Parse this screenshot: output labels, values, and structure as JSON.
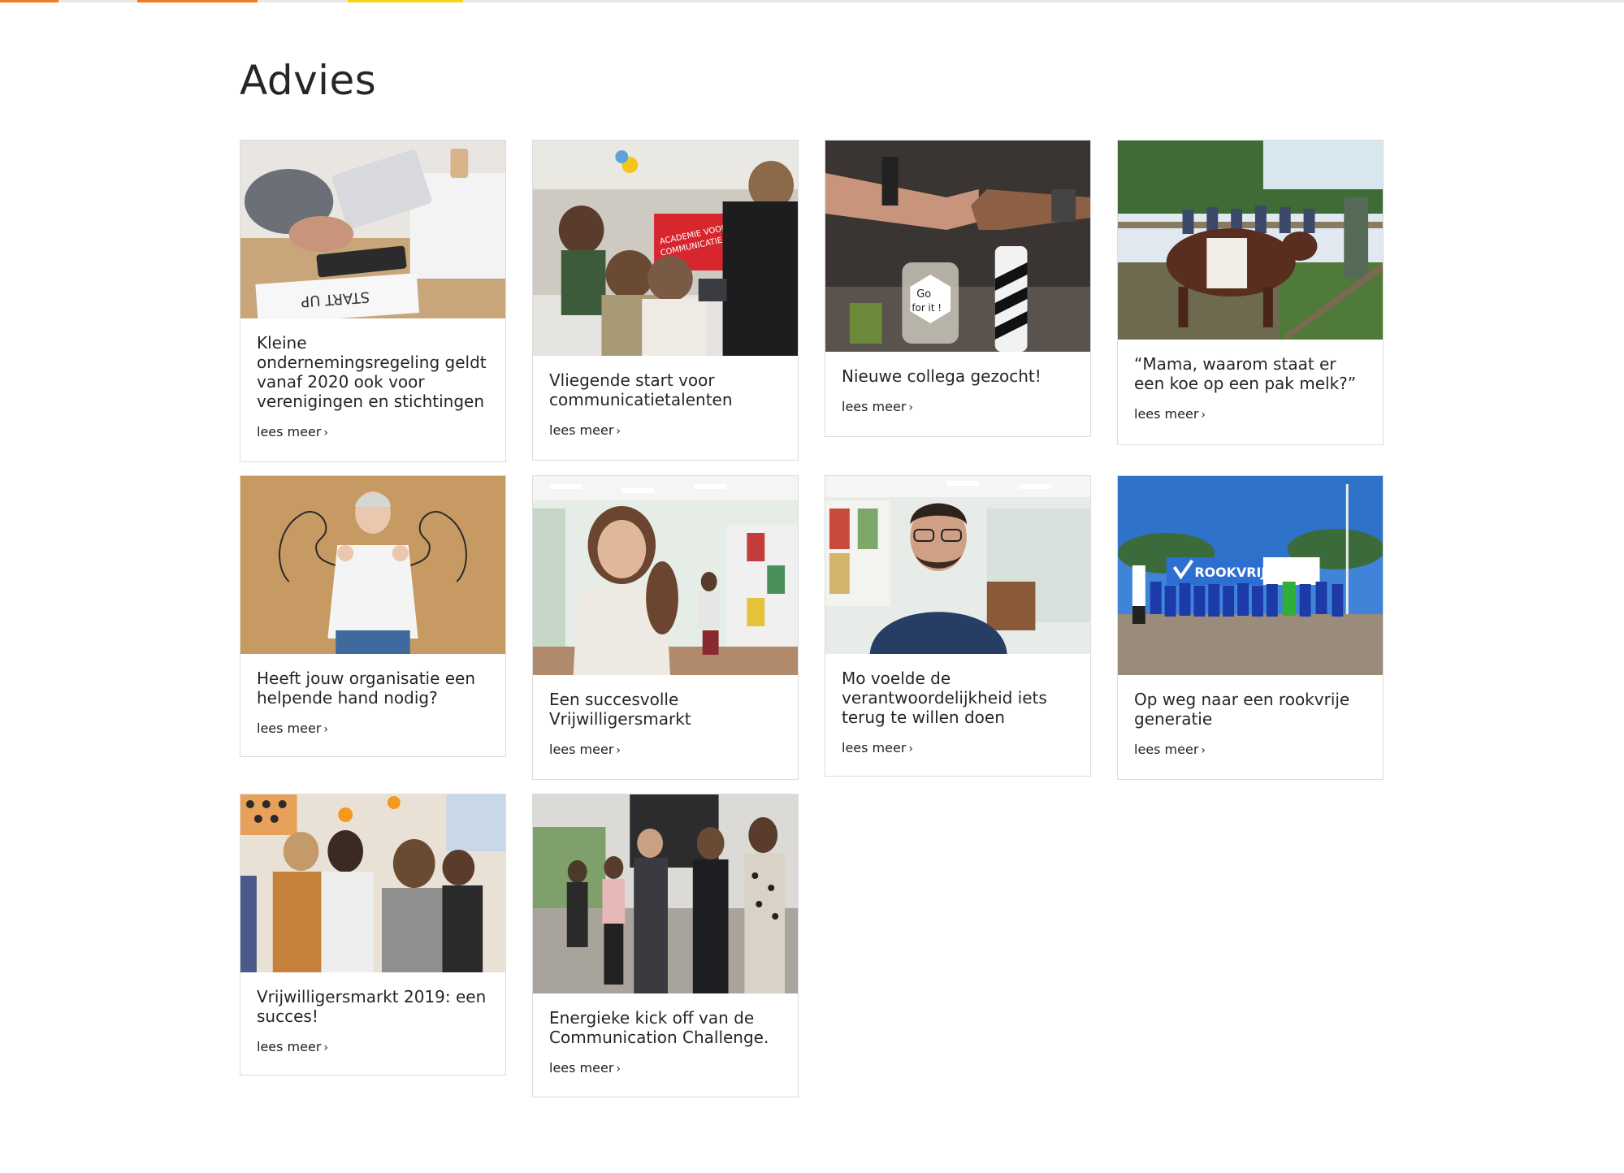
{
  "brand": {
    "stripe_colors": [
      "#f47a20",
      "#f47a20",
      "#f7d417"
    ]
  },
  "page": {
    "title": "Advies"
  },
  "cards": [
    {
      "title": "Kleine ondernemingsregeling geldt vanaf 2020 ook voor verenigingen en stichtingen",
      "link": "lees meer",
      "image_name": "calculator-start-up-photo"
    },
    {
      "title": "Vliegende start voor communicatietalenten",
      "link": "lees meer",
      "image_name": "communication-academy-photo",
      "image_text": "ACADEMIE VOOR COMMUNICATIE"
    },
    {
      "title": "Nieuwe collega gezocht!",
      "link": "lees meer",
      "image_name": "fist-bump-go-for-it-photo",
      "image_text": "Go for it !"
    },
    {
      "title": "“Mama, waarom staat er een koe op een pak melk?”",
      "link": "lees meer",
      "image_name": "cow-at-fence-photo"
    },
    {
      "title": "Heeft jouw organisatie een helpende hand nodig?",
      "link": "lees meer",
      "image_name": "strong-arms-woman-photo"
    },
    {
      "title": "Een succesvolle Vrijwilligersmarkt",
      "link": "lees meer",
      "image_name": "smiling-woman-office-photo"
    },
    {
      "title": "Mo voelde de verantwoordelijkheid iets terug te willen doen",
      "link": "lees meer",
      "image_name": "man-glasses-office-photo"
    },
    {
      "title": "Op weg naar een rookvrije generatie",
      "link": "lees meer",
      "image_name": "football-team-rookvrij-photo",
      "image_text": "ROOKVRIJ"
    },
    {
      "title": "Vrijwilligersmarkt 2019: een succes!",
      "link": "lees meer",
      "image_name": "volunteer-market-crowd-photo"
    },
    {
      "title": "Energieke kick off van de Communication Challenge.",
      "link": "lees meer",
      "image_name": "kick-off-group-photo"
    }
  ]
}
